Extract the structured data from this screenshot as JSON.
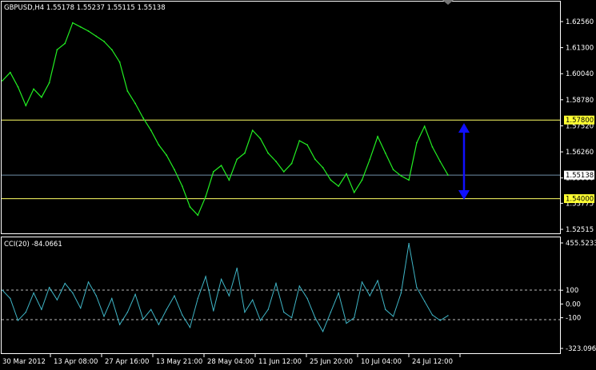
{
  "main_header": "GBPUSD,H4  1.55178 1.55237 1.55115 1.55138",
  "indicator_header": "CCI(20) -84.0661",
  "colors": {
    "background": "#000000",
    "frame": "#ffffff",
    "price_line": "#22ee22",
    "cci_line": "#3fb5c6",
    "level_line": "#ffff66",
    "level_tag_bg": "#ffff33",
    "bid_line": "#6f8ea8",
    "bid_tag_bg": "#ffffff",
    "arrow": "#1010ff",
    "dashed_level": "#bbbbbb"
  },
  "price_axis": {
    "ticks": [
      "1.62560",
      "1.61300",
      "1.60040",
      "1.58780",
      "1.57520",
      "1.56260",
      "1.55000",
      "1.53775",
      "1.52515"
    ],
    "tags": [
      {
        "value": 1.578,
        "label": "1.57800",
        "type": "level"
      },
      {
        "value": 1.55138,
        "label": "1.55138",
        "type": "bid"
      },
      {
        "value": 1.54,
        "label": "1.54000",
        "type": "level"
      }
    ]
  },
  "cci_axis": {
    "ticks": [
      "455.5233",
      "100",
      "0.00",
      "-100",
      "-323.096"
    ]
  },
  "time_axis": [
    "30 Mar 2012",
    "13 Apr 08:00",
    "27 Apr 16:00",
    "13 May 21:00",
    "28 May 04:00",
    "11 Jun 12:00",
    "25 Jun 20:00",
    "10 Jul 04:00",
    "24 Jul 12:00"
  ],
  "chart_data": {
    "type": "line",
    "symbol": "GBPUSD",
    "timeframe": "H4",
    "x": [
      "30 Mar 2012",
      "13 Apr 08:00",
      "27 Apr 16:00",
      "13 May 21:00",
      "28 May 04:00",
      "11 Jun 12:00",
      "25 Jun 20:00",
      "10 Jul 04:00",
      "24 Jul 12:00"
    ],
    "series": [
      {
        "name": "GBPUSD,H4",
        "values": [
          1.597,
          1.601,
          1.594,
          1.585,
          1.593,
          1.589,
          1.596,
          1.612,
          1.615,
          1.625,
          1.623,
          1.621,
          1.6185,
          1.616,
          1.612,
          1.606,
          1.592,
          1.586,
          1.579,
          1.573,
          1.566,
          1.561,
          1.554,
          1.546,
          1.536,
          1.532,
          1.541,
          1.553,
          1.556,
          1.549,
          1.559,
          1.562,
          1.573,
          1.569,
          1.562,
          1.558,
          1.553,
          1.557,
          1.568,
          1.566,
          1.559,
          1.555,
          1.549,
          1.546,
          1.552,
          1.543,
          1.549,
          1.559,
          1.57,
          1.562,
          1.554,
          1.551,
          1.549,
          1.567,
          1.575,
          1.565,
          1.558,
          1.5514
        ]
      }
    ],
    "ylim": [
      1.52515,
      1.6256
    ],
    "levels": [
      1.578,
      1.54
    ],
    "last_price": 1.55138,
    "indicator": {
      "name": "CCI(20)",
      "last_value": -84.0661,
      "ylim": [
        -323.096,
        455.5233
      ],
      "levels": [
        100,
        -100
      ],
      "values": [
        100,
        40,
        -120,
        -60,
        80,
        -40,
        120,
        30,
        150,
        80,
        -30,
        160,
        60,
        -90,
        40,
        -150,
        -60,
        70,
        -110,
        -40,
        -150,
        -40,
        60,
        -80,
        -170,
        40,
        200,
        -50,
        180,
        60,
        260,
        -60,
        30,
        -120,
        -40,
        150,
        -60,
        -100,
        130,
        40,
        -100,
        -200,
        -60,
        80,
        -140,
        -100,
        160,
        60,
        170,
        -40,
        -90,
        80,
        440,
        120,
        20,
        -80,
        -120,
        -84
      ]
    }
  }
}
